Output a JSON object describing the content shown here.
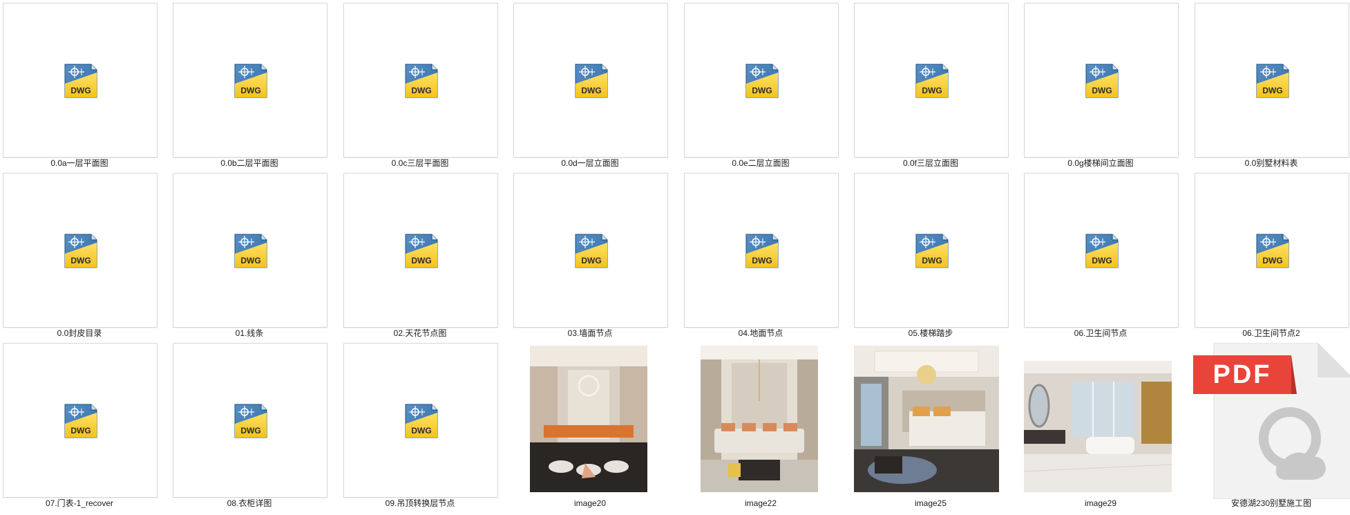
{
  "window": {
    "view": "large-icons"
  },
  "colors": {
    "dwg_blue": "#2f6ea8",
    "dwg_yellow": "#f2c31c",
    "pdf_red": "#e8443a",
    "pdf_paper": "#f2f2f2",
    "pdf_logo": "#c8c8c8"
  },
  "files": [
    {
      "name": "0.0a一层平面图",
      "type": "dwg",
      "icon": "dwg-file-icon"
    },
    {
      "name": "0.0b二层平面图",
      "type": "dwg",
      "icon": "dwg-file-icon"
    },
    {
      "name": "0.0c三层平面图",
      "type": "dwg",
      "icon": "dwg-file-icon"
    },
    {
      "name": "0.0d一层立面图",
      "type": "dwg",
      "icon": "dwg-file-icon"
    },
    {
      "name": "0.0e二层立面图",
      "type": "dwg",
      "icon": "dwg-file-icon"
    },
    {
      "name": "0.0f三层立面图",
      "type": "dwg",
      "icon": "dwg-file-icon"
    },
    {
      "name": "0.0g楼梯间立面图",
      "type": "dwg",
      "icon": "dwg-file-icon"
    },
    {
      "name": "0.0别墅材料表",
      "type": "dwg",
      "icon": "dwg-file-icon"
    },
    {
      "name": "0.0封皮目录",
      "type": "dwg",
      "icon": "dwg-file-icon"
    },
    {
      "name": "01.线条",
      "type": "dwg",
      "icon": "dwg-file-icon"
    },
    {
      "name": "02.天花节点图",
      "type": "dwg",
      "icon": "dwg-file-icon"
    },
    {
      "name": "03.墙面节点",
      "type": "dwg",
      "icon": "dwg-file-icon"
    },
    {
      "name": "04.地面节点",
      "type": "dwg",
      "icon": "dwg-file-icon"
    },
    {
      "name": "05.楼梯踏步",
      "type": "dwg",
      "icon": "dwg-file-icon"
    },
    {
      "name": "06.卫生间节点",
      "type": "dwg",
      "icon": "dwg-file-icon"
    },
    {
      "name": "06.卫生间节点2",
      "type": "dwg",
      "icon": "dwg-file-icon"
    },
    {
      "name": "07.门表-1_recover",
      "type": "dwg",
      "icon": "dwg-file-icon"
    },
    {
      "name": "08.衣柜详图",
      "type": "dwg",
      "icon": "dwg-file-icon"
    },
    {
      "name": "09.吊顶转换层节点",
      "type": "dwg",
      "icon": "dwg-file-icon"
    },
    {
      "name": "image20",
      "type": "image",
      "icon": "dining-room-photo",
      "scene": "dining"
    },
    {
      "name": "image22",
      "type": "image",
      "icon": "living-room-photo",
      "scene": "living"
    },
    {
      "name": "image25",
      "type": "image",
      "icon": "bedroom-photo",
      "scene": "bedroom"
    },
    {
      "name": "image29",
      "type": "image",
      "icon": "bathroom-photo",
      "scene": "bathroom"
    },
    {
      "name": "安德湖230别墅施工图",
      "type": "pdf",
      "icon": "pdf-file-icon",
      "badge": "PDF"
    }
  ]
}
